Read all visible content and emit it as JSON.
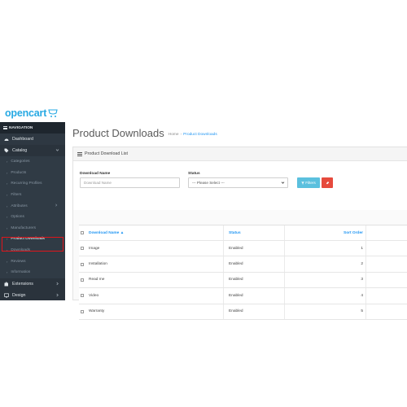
{
  "brand": {
    "name": "opencart",
    "accent": "#27a9e3"
  },
  "sidebar": {
    "header": "NAVIGATION",
    "dashboard": {
      "label": "Dashboard",
      "icon": "dashboard-icon"
    },
    "catalog": {
      "label": "Catalog",
      "icon": "tag-icon"
    },
    "catalog_items": [
      {
        "label": "Categories"
      },
      {
        "label": "Products"
      },
      {
        "label": "Recurring Profiles"
      },
      {
        "label": "Filters"
      },
      {
        "label": "Attributes"
      },
      {
        "label": "Options"
      },
      {
        "label": "Manufacturers"
      },
      {
        "label": "Product Downloads"
      },
      {
        "label": "Downloads"
      },
      {
        "label": "Reviews"
      },
      {
        "label": "Information"
      }
    ],
    "extensions": {
      "label": "Extensions",
      "icon": "puzzle-icon"
    },
    "design": {
      "label": "Design",
      "icon": "monitor-icon"
    },
    "highlight_color": "#e0151b"
  },
  "header": {
    "title": "Product Downloads",
    "breadcrumb": {
      "home": "Home",
      "separator": "›",
      "current": "Product Downloads"
    }
  },
  "panel": {
    "title": "Product Download List",
    "filter": {
      "name_label": "Download Name",
      "name_placeholder": "Download Name",
      "status_label": "Status",
      "status_selected": "--- Please Select ---",
      "filter_button": "Filters"
    }
  },
  "table": {
    "columns": {
      "name": "Download Name ▲",
      "status": "Status",
      "sort": "Sort Order"
    },
    "rows": [
      {
        "name": "Image",
        "status": "Enabled",
        "sort": "1"
      },
      {
        "name": "Installation",
        "status": "Enabled",
        "sort": "2"
      },
      {
        "name": "Read me",
        "status": "Enabled",
        "sort": "3"
      },
      {
        "name": "Video",
        "status": "Enabled",
        "sort": "4"
      },
      {
        "name": "Warranty",
        "status": "Enabled",
        "sort": "5"
      }
    ]
  }
}
